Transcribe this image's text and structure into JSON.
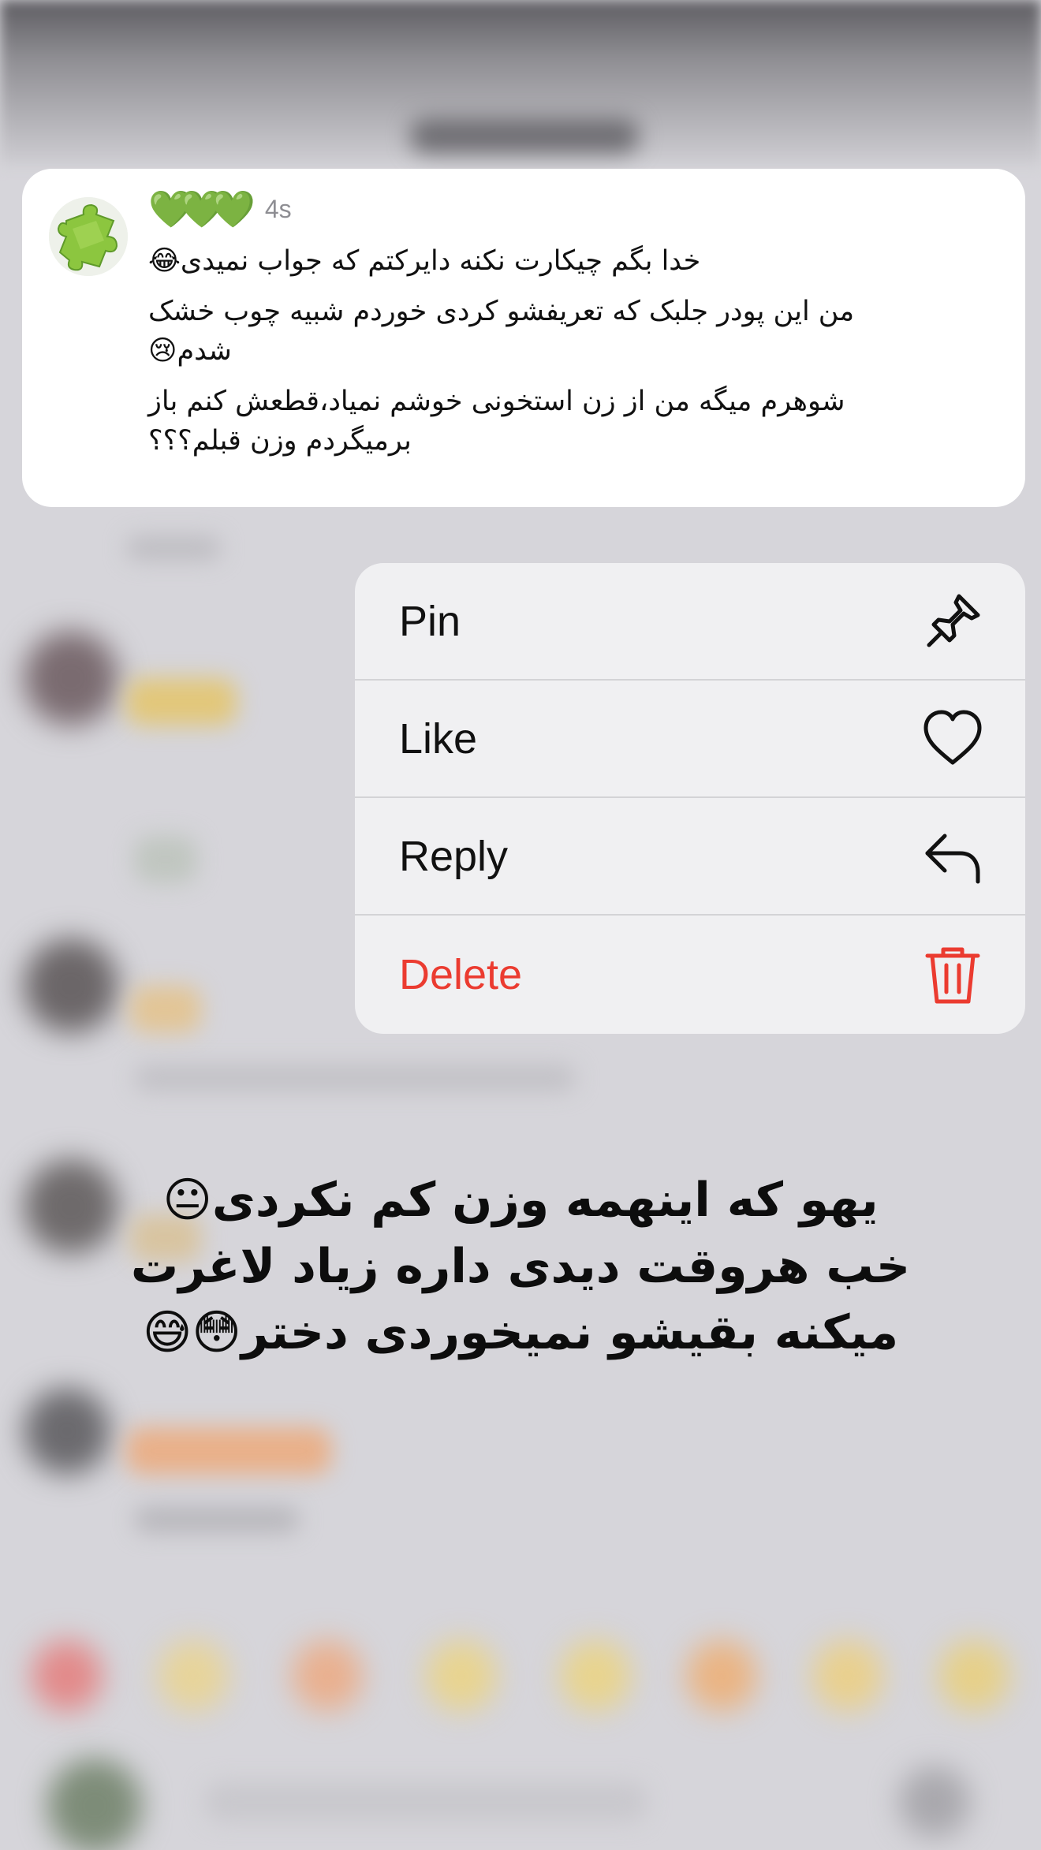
{
  "message": {
    "username": "",
    "username_emoji": "💚💚💚",
    "time": "4s",
    "lines": [
      "خدا بگم چیکارت نکنه دایرکتم که جواب نمیدی😂",
      "من این پودر جلبک که تعریفشو کردی خوردم شبیه چوب خشک شدم😢",
      "شوهرم میگه من از زن استخونی خوشم نمیاد،قطعش کنم باز برمیگردم وزن قبلم؟؟؟"
    ]
  },
  "context_menu": {
    "items": [
      {
        "label": "Pin",
        "icon": "pin-icon"
      },
      {
        "label": "Like",
        "icon": "heart-icon"
      },
      {
        "label": "Reply",
        "icon": "reply-icon"
      },
      {
        "label": "Delete",
        "icon": "trash-icon",
        "color": "#eb3b30"
      }
    ]
  },
  "overlay_caption": {
    "lines": [
      "یهو که اینهمه وزن کم نکردی😐",
      "خب هروقت دیدی داره زیاد لاغرت",
      "میکنه بقیشو نمیخوردی دختر😳😅"
    ]
  }
}
